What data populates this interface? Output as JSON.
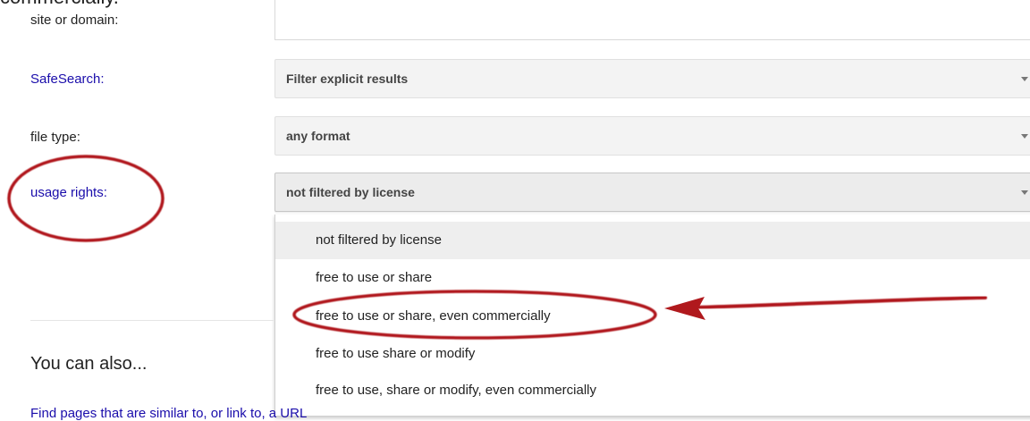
{
  "top_text": "commercially.",
  "fields": {
    "site": {
      "label": "site or domain:",
      "value": ""
    },
    "safesearch": {
      "label": "SafeSearch:",
      "value": "Filter explicit results"
    },
    "file_type": {
      "label": "file type:",
      "value": "any format"
    },
    "usage_rights": {
      "label": "usage rights:",
      "value": "not filtered by license"
    }
  },
  "usage_rights_options": [
    "not filtered by license",
    "free to use or share",
    "free to use or share, even commercially",
    "free to use share or modify",
    "free to use, share or modify, even commercially"
  ],
  "also_heading": "You can also...",
  "find_link": "Find pages that are similar to, or link to, a URL",
  "annotation_color": "#b0191d"
}
